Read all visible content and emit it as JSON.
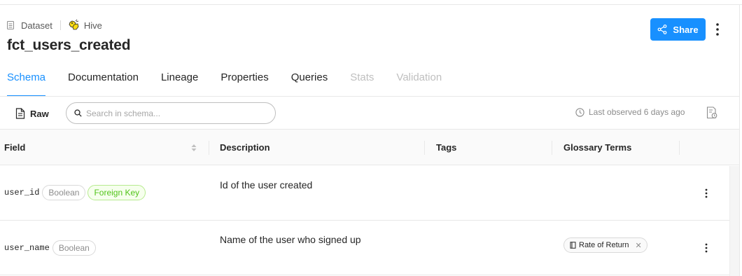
{
  "breadcrumb": {
    "entity_type": "Dataset",
    "platform": "Hive"
  },
  "page": {
    "title": "fct_users_created"
  },
  "header": {
    "share_label": "Share"
  },
  "tabs": [
    {
      "label": "Schema",
      "state": "active"
    },
    {
      "label": "Documentation",
      "state": "normal"
    },
    {
      "label": "Lineage",
      "state": "normal"
    },
    {
      "label": "Properties",
      "state": "normal"
    },
    {
      "label": "Queries",
      "state": "normal"
    },
    {
      "label": "Stats",
      "state": "disabled"
    },
    {
      "label": "Validation",
      "state": "disabled"
    }
  ],
  "toolbar": {
    "raw_label": "Raw",
    "search_placeholder": "Search in schema...",
    "last_observed": "Last observed 6 days ago"
  },
  "table": {
    "columns": [
      "Field",
      "Description",
      "Tags",
      "Glossary Terms"
    ],
    "rows": [
      {
        "field": "user_id",
        "type": "Boolean",
        "key_badge": "Foreign Key",
        "description": "Id of the user created",
        "glossary_term": ""
      },
      {
        "field": "user_name",
        "type": "Boolean",
        "key_badge": "",
        "description": "Name of the user who signed up",
        "glossary_term": "Rate of Return"
      }
    ]
  },
  "icons": {
    "breadcrumb_type": "dataset-doc-icon",
    "platform": "hive-logo-icon",
    "share": "share-icon",
    "more": "more-vertical-icon",
    "raw": "file-text-icon",
    "search": "search-icon",
    "clock": "clock-icon",
    "schema_blame": "file-history-icon",
    "sort": "sort-icon",
    "glossary": "book-icon",
    "remove": "close-icon"
  },
  "colors": {
    "accent": "#1890ff",
    "foreign_key": "#52c41a",
    "disabled": "#bfbfbf"
  }
}
